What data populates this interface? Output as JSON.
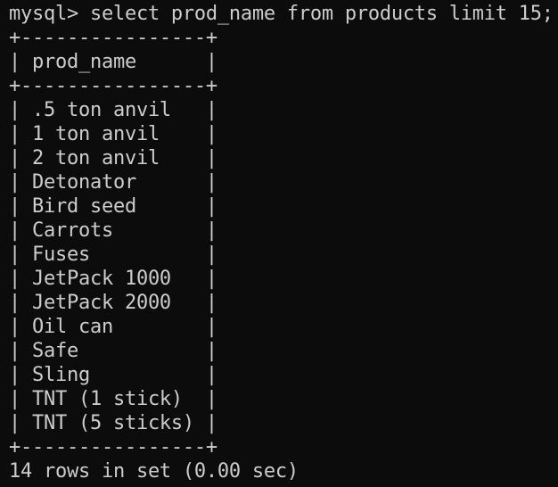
{
  "terminal": {
    "command_line": "mysql> select prod_name from products limit 15;",
    "table_border": "+----------------+",
    "header_row": "| prod_name      |",
    "rows": [
      "| .5 ton anvil   |",
      "| 1 ton anvil    |",
      "| 2 ton anvil    |",
      "| Detonator      |",
      "| Bird seed      |",
      "| Carrots        |",
      "| Fuses          |",
      "| JetPack 1000   |",
      "| JetPack 2000   |",
      "| Oil can        |",
      "| Safe           |",
      "| Sling          |",
      "| TNT (1 stick)  |",
      "| TNT (5 sticks) |"
    ],
    "result_summary": "14 rows in set (0.00 sec)",
    "colors": {
      "background": "#0c0c0c",
      "text": "#cccccc"
    }
  }
}
